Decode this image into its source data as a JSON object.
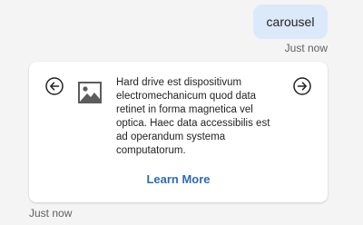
{
  "user_message": {
    "text": "carousel",
    "timestamp": "Just now"
  },
  "bot_message": {
    "timestamp": "Just now",
    "card": {
      "text": "Hard drive est dispositivum electromechanicum quod data retinet in forma magnetica vel optica. Haec data accessibilis est ad operandum systema computatorum.",
      "button_label": "Learn More",
      "image_icon": "image-placeholder-icon",
      "prev_icon": "arrow-left-circle-icon",
      "next_icon": "arrow-right-circle-icon"
    }
  },
  "colors": {
    "user_bubble": "#dbe9fb",
    "link": "#2f6bb3",
    "background": "#f4f4f4"
  }
}
